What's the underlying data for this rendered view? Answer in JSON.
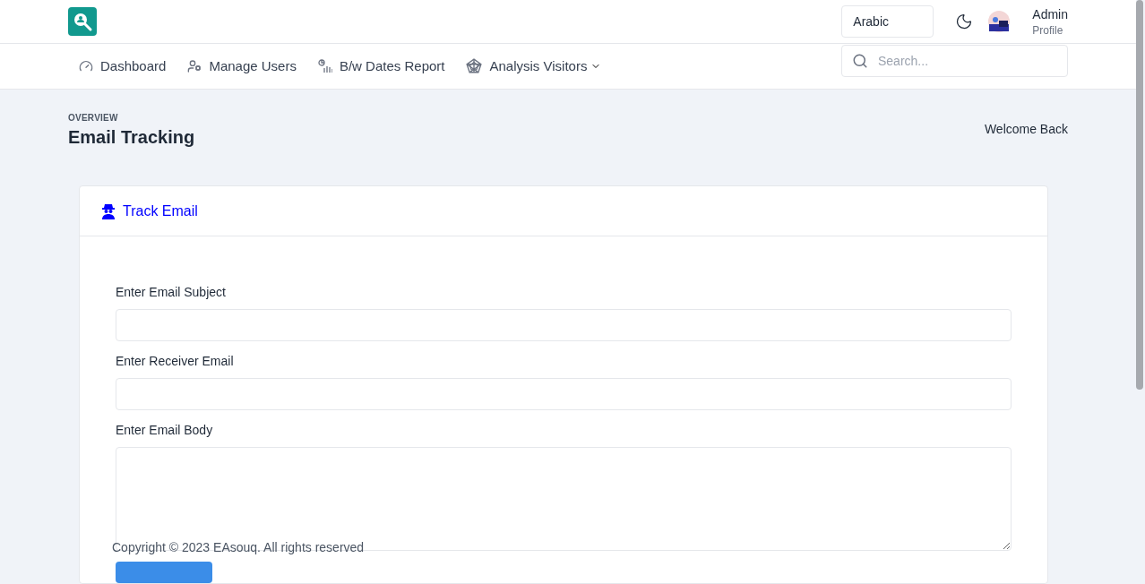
{
  "header": {
    "language": "Arabic",
    "user": {
      "name": "Admin",
      "role": "Profile"
    }
  },
  "nav": {
    "items": [
      {
        "label": "Dashboard",
        "kind": "dashboard",
        "dropdown": false
      },
      {
        "label": "Manage Users",
        "kind": "users",
        "dropdown": false
      },
      {
        "label": "B/w Dates Report",
        "kind": "report",
        "dropdown": false
      },
      {
        "label": "Analysis Visitors",
        "kind": "analysis",
        "dropdown": true
      }
    ],
    "search": {
      "placeholder": "Search..."
    }
  },
  "page": {
    "eyebrow": "OVERVIEW",
    "title": "Email Tracking",
    "welcome": "Welcome Back"
  },
  "card": {
    "title": "Track Email",
    "fields": [
      {
        "label": "Enter Email Subject",
        "kind": "input"
      },
      {
        "label": "Enter Receiver Email",
        "kind": "input"
      },
      {
        "label": "Enter Email Body",
        "kind": "textarea"
      }
    ]
  },
  "footer": {
    "copyright": "Copyright © 2023 EAsouq. All rights reserved"
  }
}
